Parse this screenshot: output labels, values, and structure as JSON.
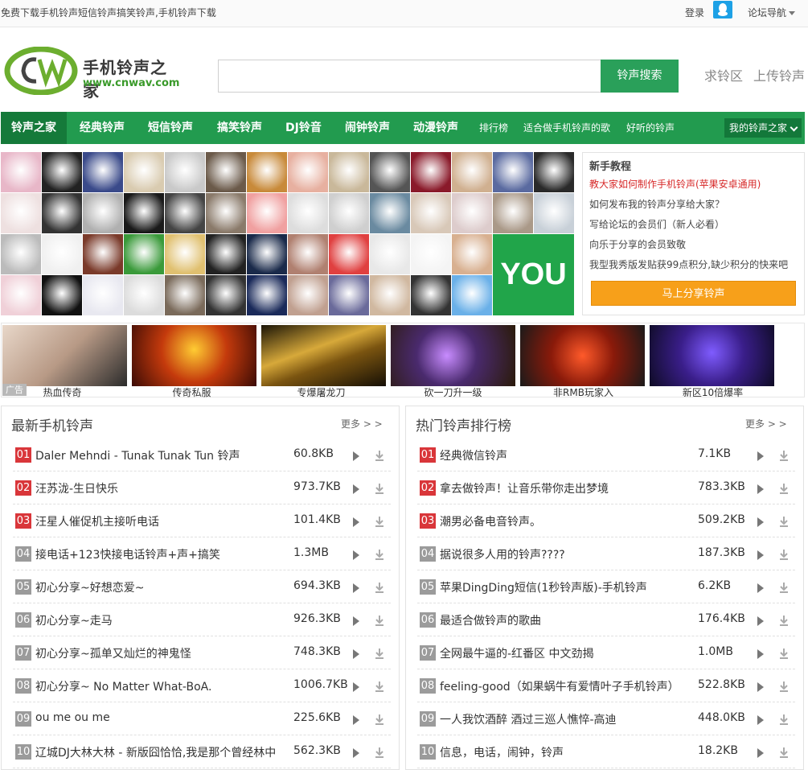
{
  "topbar": {
    "slogan": "免费下载手机铃声短信铃声搞笑铃声,手机铃声下载",
    "login": "登录",
    "forum_nav": "论坛导航"
  },
  "header": {
    "logo_cn": "手机铃声之家",
    "logo_url": "www.cnwav.com",
    "search_placeholder": "",
    "search_button": "铃声搜索",
    "link_request": "求铃区",
    "link_upload": "上传铃声"
  },
  "nav": {
    "items": [
      "铃声之家",
      "经典铃声",
      "短信铃声",
      "搞笑铃声",
      "DJ铃音",
      "闹钟铃声",
      "动漫铃声",
      "排行榜",
      "适合做手机铃声的歌",
      "好听的铃声"
    ],
    "mine": "我的铃声之家"
  },
  "avatars": {
    "you_label": "YOU"
  },
  "tutorial": {
    "title": "新手教程",
    "lines": [
      "教大家如何制作手机铃声(苹果安卓通用)",
      "如何发布我的铃声分享给大家？",
      "写给论坛的会员们（新人必看）",
      "向乐于分享的会员致敬",
      "我型我秀版发贴获99点积分,缺少积分的快来吧"
    ],
    "share_button": "马上分享铃声"
  },
  "ads": {
    "tag": "广告",
    "captions": [
      "热血传奇",
      "传奇私服",
      "专爆屠龙刀",
      "砍一刀升一级",
      "非RMB玩家入",
      "新区10倍爆率"
    ]
  },
  "latest": {
    "title": "最新手机铃声",
    "more": "更多 > >",
    "rows": [
      {
        "num": "01",
        "title": "Daler Mehndi - Tunak Tunak Tun 铃声",
        "size": "60.8KB"
      },
      {
        "num": "02",
        "title": "汪苏泷-生日快乐",
        "size": "973.7KB"
      },
      {
        "num": "03",
        "title": "汪星人催促机主接听电话",
        "size": "101.4KB"
      },
      {
        "num": "04",
        "title": "接电话+123快接电话铃声+声+搞笑",
        "size": "1.3MB"
      },
      {
        "num": "05",
        "title": "初心分享~好想恋爱~",
        "size": "694.3KB"
      },
      {
        "num": "06",
        "title": "初心分享~走马",
        "size": "926.3KB"
      },
      {
        "num": "07",
        "title": "初心分享~孤单又灿烂的神鬼怪",
        "size": "748.3KB"
      },
      {
        "num": "08",
        "title": "初心分享~ No Matter What-BoA.",
        "size": "1006.7KB"
      },
      {
        "num": "09",
        "title": "ou me ou me",
        "size": "225.6KB"
      },
      {
        "num": "10",
        "title": "辽城DJ大林大林 - 新版囧恰恰,我是那个曾经林中",
        "size": "562.3KB"
      }
    ]
  },
  "hot": {
    "title": "热门铃声排行榜",
    "more": "更多 > >",
    "rows": [
      {
        "num": "01",
        "title": "经典微信铃声",
        "size": "7.1KB"
      },
      {
        "num": "02",
        "title": "拿去做铃声！让音乐带你走出梦境",
        "size": "783.3KB"
      },
      {
        "num": "03",
        "title": "潮男必备电音铃声。",
        "size": "509.2KB"
      },
      {
        "num": "04",
        "title": "据说很多人用的铃声????",
        "size": "187.3KB"
      },
      {
        "num": "05",
        "title": "苹果DingDing短信(1秒铃声版)-手机铃声",
        "size": "6.2KB"
      },
      {
        "num": "06",
        "title": "最适合做铃声的歌曲",
        "size": "176.4KB"
      },
      {
        "num": "07",
        "title": "全网最牛逼的-红番区 中文劲揭",
        "size": "1.0MB"
      },
      {
        "num": "08",
        "title": "feeling-good（如果蜗牛有爱情叶子手机铃声）",
        "size": "522.8KB"
      },
      {
        "num": "09",
        "title": "一人我饮酒醉 酒过三巡人憔悴-高迪",
        "size": "448.0KB"
      },
      {
        "num": "10",
        "title": "信息，电话，闹钟，铃声",
        "size": "18.2KB"
      }
    ]
  }
}
